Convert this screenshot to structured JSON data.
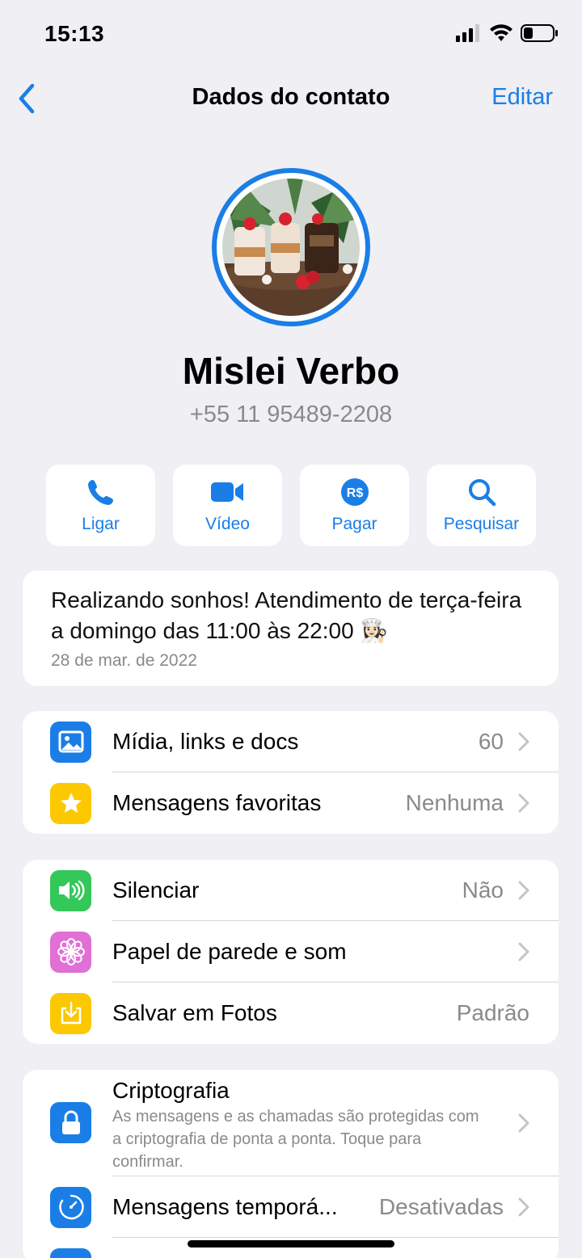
{
  "status": {
    "time": "15:13"
  },
  "nav": {
    "title": "Dados do contato",
    "edit_label": "Editar"
  },
  "contact": {
    "name": "Mislei Verbo",
    "phone": "+55 11 95489-2208"
  },
  "actions": [
    {
      "label": "Ligar",
      "icon": "phone-icon"
    },
    {
      "label": "Vídeo",
      "icon": "video-icon"
    },
    {
      "label": "Pagar",
      "icon": "payment-icon"
    },
    {
      "label": "Pesquisar",
      "icon": "search-icon"
    }
  ],
  "about": {
    "text": "Realizando sonhos! Atendimento de terça-feira a domingo das 11:00 às 22:00 👩🏻‍🍳",
    "date": "28 de mar. de 2022"
  },
  "group1": [
    {
      "label": "Mídia, links e docs",
      "value": "60",
      "icon": "photo-icon",
      "color": "#1a7ee6"
    },
    {
      "label": "Mensagens favoritas",
      "value": "Nenhuma",
      "icon": "star-icon",
      "color": "#fcc800"
    }
  ],
  "group2": [
    {
      "label": "Silenciar",
      "value": "Não",
      "icon": "speaker-icon",
      "color": "#34c759"
    },
    {
      "label": "Papel de parede e som",
      "value": "",
      "icon": "flower-icon",
      "color": "#e06fd6"
    },
    {
      "label": "Salvar em Fotos",
      "value": "Padrão",
      "icon": "save-icon",
      "color": "#fcc800"
    }
  ],
  "group3": {
    "encryption_title": "Criptografia",
    "encryption_desc": "As mensagens e as chamadas são protegidas com a criptografia de ponta a ponta. Toque para confirmar.",
    "disappearing_label": "Mensagens temporá...",
    "disappearing_value": "Desativadas"
  },
  "colors": {
    "accent": "#1a7ee6",
    "background": "#efeff4"
  }
}
